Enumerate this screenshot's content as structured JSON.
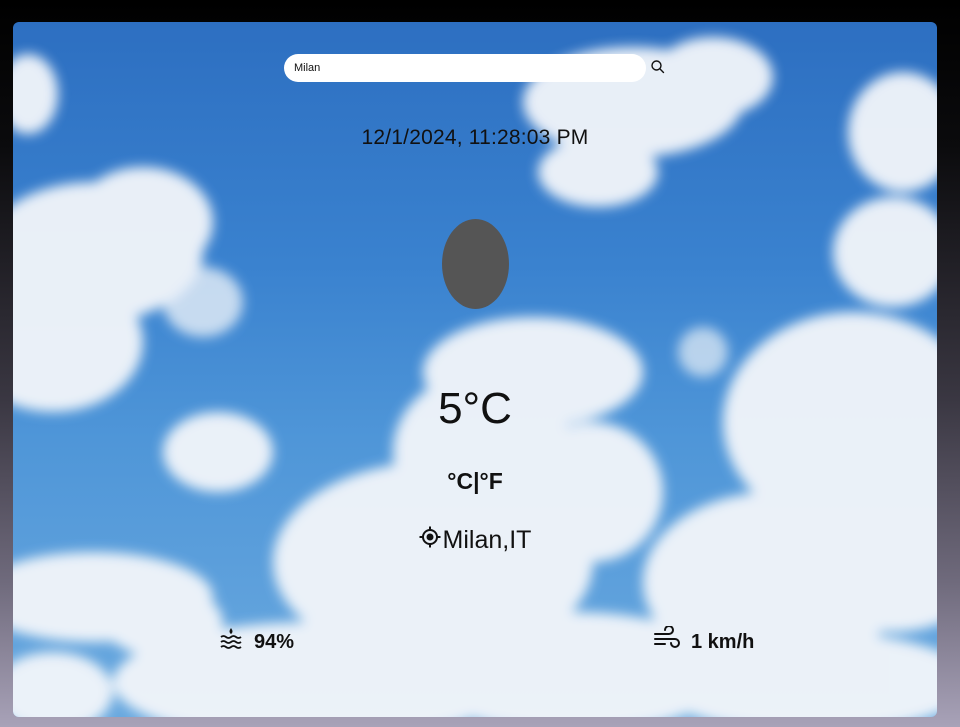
{
  "search": {
    "value": "Milan",
    "icon": "search-icon"
  },
  "datetime": "12/1/2024, 11:28:03 PM",
  "weather": {
    "icon": "weather-icon",
    "temperature": "5°C",
    "unit_celsius": "°C",
    "unit_separator": "|",
    "unit_fahrenheit": "°F"
  },
  "location": {
    "icon": "location-target-icon",
    "name": "Milan,IT"
  },
  "stats": {
    "humidity": {
      "icon": "humidity-icon",
      "value": "94%"
    },
    "wind": {
      "icon": "wind-icon",
      "value": "1 km/h"
    }
  },
  "colors": {
    "sky_top": "#2d6fc1",
    "sky_bottom": "#6aa9df",
    "cloud": "#f3f6fa",
    "weather_icon": "#555555",
    "text": "#111111"
  }
}
